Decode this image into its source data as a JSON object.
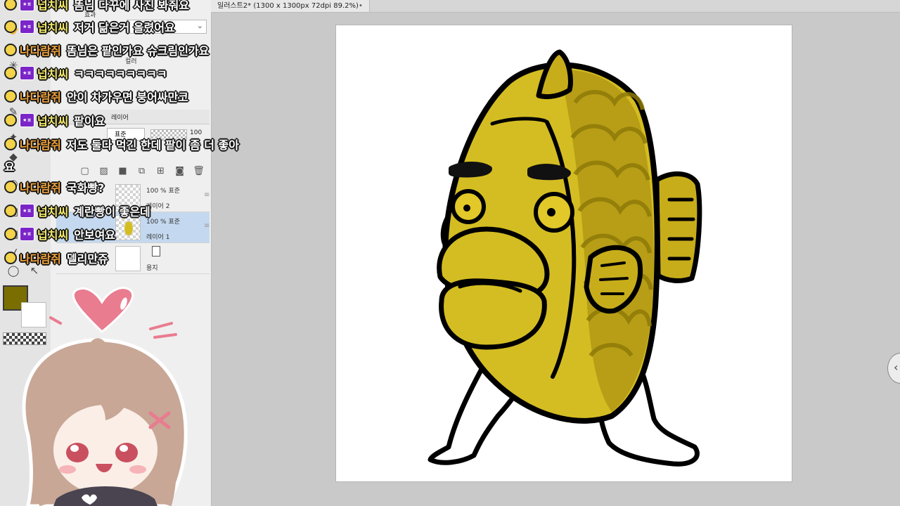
{
  "document": {
    "tab_title": "일러스트2* (1300 x 1300px 72dpi 89.2%)",
    "modified_dot": "•"
  },
  "panels": {
    "effect_label": "효과",
    "color_label": "컬러",
    "layer_tab_label": "레이어",
    "blend_mode": "표준",
    "opacity": "100"
  },
  "layers": [
    {
      "mode": "100 % 표준",
      "name": "레이어 2"
    },
    {
      "mode": "100 % 표준",
      "name": "레이어 1"
    },
    {
      "mode": "",
      "name": "용지"
    }
  ],
  "colors": {
    "main": "#7a6e00",
    "sub": "#ffffff",
    "fish_body": "#d4bd22",
    "fish_shadow": "#b79e16",
    "purple_badge": "#7b25c8",
    "nick_yellow": "#f3e96a",
    "nick_orange": "#f0a13a"
  },
  "chat": [
    {
      "user": "넙치씨",
      "badge": "★ㅍ",
      "message": "똠님 다꾸에 사진 봐줘요"
    },
    {
      "user": "넙치씨",
      "badge": "★ㅍ",
      "message": "저거 닮은거 올렸어요"
    },
    {
      "user": "나다람쥐",
      "badge": "",
      "message": "똠님은 팥인가요 슈크림인가요"
    },
    {
      "user": "넙치씨",
      "badge": "★ㅍ",
      "message": "ㅋㅋㅋㅋㅋㅋㅋㅋㅋ"
    },
    {
      "user": "나다람쥐",
      "badge": "",
      "message": "안이 차가우면 붕어싸만코"
    },
    {
      "user": "넙치씨",
      "badge": "★ㅍ",
      "message": "팥이요"
    },
    {
      "user": "나다람쥐",
      "badge": "",
      "message": "저도 둘다 먹긴 한데 팥이 좀 더 좋아"
    },
    {
      "user": "",
      "badge": "",
      "message": "요"
    },
    {
      "user": "나다람쥐",
      "badge": "",
      "message": "국화빵?"
    },
    {
      "user": "넙치씨",
      "badge": "★ㅍ",
      "message": "계란빵이 좋은데"
    },
    {
      "user": "넙치씨",
      "badge": "★ㅍ",
      "message": "안보여요"
    },
    {
      "user": "나다람쥐",
      "badge": "",
      "message": "델리만쥬"
    }
  ],
  "icons": {
    "tools": [
      "brush-icon",
      "pen-icon",
      "eraser-icon",
      "airbrush-icon",
      "lasso-icon",
      "move-icon"
    ],
    "layer_toolbar": [
      "new-raster-layer-icon",
      "new-vector-layer-icon",
      "new-folder-icon",
      "copy-layer-icon",
      "merge-icon",
      "mask-icon",
      "delete-icon"
    ]
  }
}
